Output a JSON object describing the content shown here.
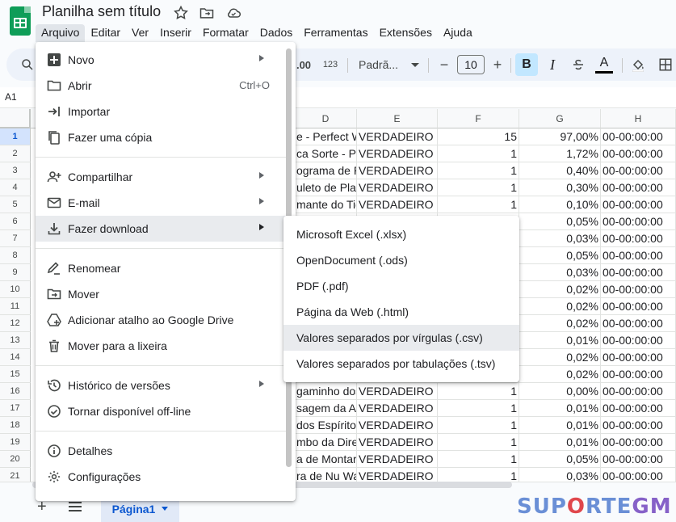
{
  "doc": {
    "title": "Planilha sem título"
  },
  "menubar": [
    "Arquivo",
    "Editar",
    "Ver",
    "Inserir",
    "Formatar",
    "Dados",
    "Ferramentas",
    "Extensões",
    "Ajuda"
  ],
  "toolbar": {
    "decimal_more": ".00",
    "number_format": "123",
    "font": "Padrã...",
    "font_size": "10",
    "bold": "B",
    "italic": "I",
    "text_color_letter": "A"
  },
  "formula_bar": {
    "cell_ref": "A1"
  },
  "columns": [
    "D",
    "E",
    "F",
    "G",
    "H"
  ],
  "rows": [
    {
      "n": "1",
      "d": "e - Perfect W",
      "e": "VERDADEIRO",
      "f": "15",
      "g": "97,00%",
      "h": "00-00:00:00"
    },
    {
      "n": "2",
      "d": "ca Sorte - Pe",
      "e": "VERDADEIRO",
      "f": "1",
      "g": "1,72%",
      "h": "00-00:00:00"
    },
    {
      "n": "3",
      "d": "ograma de P",
      "e": "VERDADEIRO",
      "f": "1",
      "g": "0,40%",
      "h": "00-00:00:00"
    },
    {
      "n": "4",
      "d": "uleto de Plati",
      "e": "VERDADEIRO",
      "f": "1",
      "g": "0,30%",
      "h": "00-00:00:00"
    },
    {
      "n": "5",
      "d": "mante do Tig",
      "e": "VERDADEIRO",
      "f": "1",
      "g": "0,10%",
      "h": "00-00:00:00"
    },
    {
      "n": "6",
      "d": "",
      "e": "",
      "f": "",
      "g": "0,05%",
      "h": "00-00:00:00"
    },
    {
      "n": "7",
      "d": "",
      "e": "",
      "f": "",
      "g": "0,03%",
      "h": "00-00:00:00"
    },
    {
      "n": "8",
      "d": "",
      "e": "",
      "f": "",
      "g": "0,05%",
      "h": "00-00:00:00"
    },
    {
      "n": "9",
      "d": "",
      "e": "",
      "f": "",
      "g": "0,03%",
      "h": "00-00:00:00"
    },
    {
      "n": "10",
      "d": "",
      "e": "",
      "f": "",
      "g": "0,02%",
      "h": "00-00:00:00"
    },
    {
      "n": "11",
      "d": "",
      "e": "",
      "f": "",
      "g": "0,02%",
      "h": "00-00:00:00"
    },
    {
      "n": "12",
      "d": "",
      "e": "",
      "f": "",
      "g": "0,02%",
      "h": "00-00:00:00"
    },
    {
      "n": "13",
      "d": "",
      "e": "",
      "f": "",
      "g": "0,01%",
      "h": "00-00:00:00"
    },
    {
      "n": "14",
      "d": "",
      "e": "",
      "f": "",
      "g": "0,02%",
      "h": "00-00:00:00"
    },
    {
      "n": "15",
      "d": "",
      "e": "",
      "f": "",
      "g": "0,02%",
      "h": "00-00:00:00"
    },
    {
      "n": "16",
      "d": "gaminho dos",
      "e": "VERDADEIRO",
      "f": "1",
      "g": "0,00%",
      "h": "00-00:00:00"
    },
    {
      "n": "17",
      "d": "sagem da Al",
      "e": "VERDADEIRO",
      "f": "1",
      "g": "0,01%",
      "h": "00-00:00:00"
    },
    {
      "n": "18",
      "d": "dos Espírito",
      "e": "VERDADEIRO",
      "f": "1",
      "g": "0,01%",
      "h": "00-00:00:00"
    },
    {
      "n": "19",
      "d": "mbo da Dire",
      "e": "VERDADEIRO",
      "f": "1",
      "g": "0,01%",
      "h": "00-00:00:00"
    },
    {
      "n": "20",
      "d": "a de Montari",
      "e": "VERDADEIRO",
      "f": "1",
      "g": "0,05%",
      "h": "00-00:00:00"
    },
    {
      "n": "21",
      "d": "ra de Nu Wa",
      "e": "VERDADEIRO",
      "f": "1",
      "g": "0,03%",
      "h": "00-00:00:00"
    }
  ],
  "file_menu": {
    "novo": "Novo",
    "abrir": "Abrir",
    "abrir_shortcut": "Ctrl+O",
    "importar": "Importar",
    "copia": "Fazer uma cópia",
    "compartilhar": "Compartilhar",
    "email": "E-mail",
    "download": "Fazer download",
    "renomear": "Renomear",
    "mover": "Mover",
    "atalho": "Adicionar atalho ao Google Drive",
    "lixeira": "Mover para a lixeira",
    "historico": "Histórico de versões",
    "offline": "Tornar disponível off-line",
    "detalhes": "Detalhes",
    "config": "Configurações"
  },
  "download_menu": [
    "Microsoft Excel (.xlsx)",
    "OpenDocument (.ods)",
    "PDF (.pdf)",
    "Página da Web (.html)",
    "Valores separados por vírgulas (.csv)",
    "Valores separados por tabulações (.tsv)"
  ],
  "sheet_tab": "Página1",
  "watermark": {
    "a": "SUP",
    "o": "O",
    "b": "RTE",
    "gm": "GM"
  }
}
